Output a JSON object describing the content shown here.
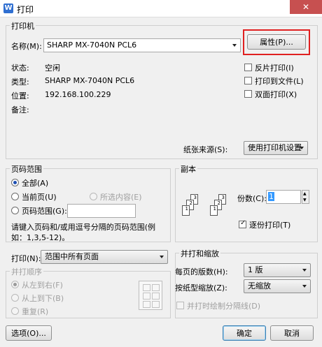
{
  "window": {
    "title": "打印",
    "app_icon": "W"
  },
  "printer": {
    "group_title": "打印机",
    "name_label": "名称(M):",
    "name_value": "SHARP MX-7040N PCL6",
    "properties_button": "属性(P)...",
    "status_label": "状态:",
    "status_value": "空闲",
    "type_label": "类型:",
    "type_value": "SHARP MX-7040N PCL6",
    "location_label": "位置:",
    "location_value": "192.168.100.229",
    "comment_label": "备注:",
    "comment_value": "",
    "reverse_print": "反片打印(I)",
    "print_to_file": "打印到文件(L)",
    "duplex": "双面打印(X)",
    "paper_source_label": "纸张来源(S):",
    "paper_source_value": "使用打印机设置"
  },
  "page_range": {
    "group_title": "页码范围",
    "all": "全部(A)",
    "current": "当前页(U)",
    "selection": "所选内容(E)",
    "range": "页码范围(G):",
    "range_value": "",
    "hint": "请键入页码和/或用逗号分隔的页码范围(例如：1,3,5-12)。"
  },
  "copies": {
    "group_title": "副本",
    "count_label": "份数(C):",
    "count_value": "1",
    "collate": "逐份打印(T)",
    "page_labels_a": [
      "3",
      "2",
      "1"
    ],
    "page_labels_b": [
      "3",
      "2",
      "1"
    ]
  },
  "print_what": {
    "label": "打印(N):",
    "value": "范围中所有页面",
    "order_title": "并打顺序",
    "left_to_right": "从左到右(F)",
    "top_to_bottom": "从上到下(B)",
    "repeat": "重复(R)"
  },
  "zoom": {
    "group_title": "并打和缩放",
    "pages_per_sheet_label": "每页的版数(H):",
    "pages_per_sheet_value": "1 版",
    "scale_label": "按纸型缩放(Z):",
    "scale_value": "无缩放",
    "draw_separator": "并打时绘制分隔线(D)"
  },
  "footer": {
    "options": "选项(O)...",
    "ok": "确定",
    "cancel": "取消"
  },
  "colors": {
    "highlight": "#e02020",
    "close": "#c75050"
  }
}
